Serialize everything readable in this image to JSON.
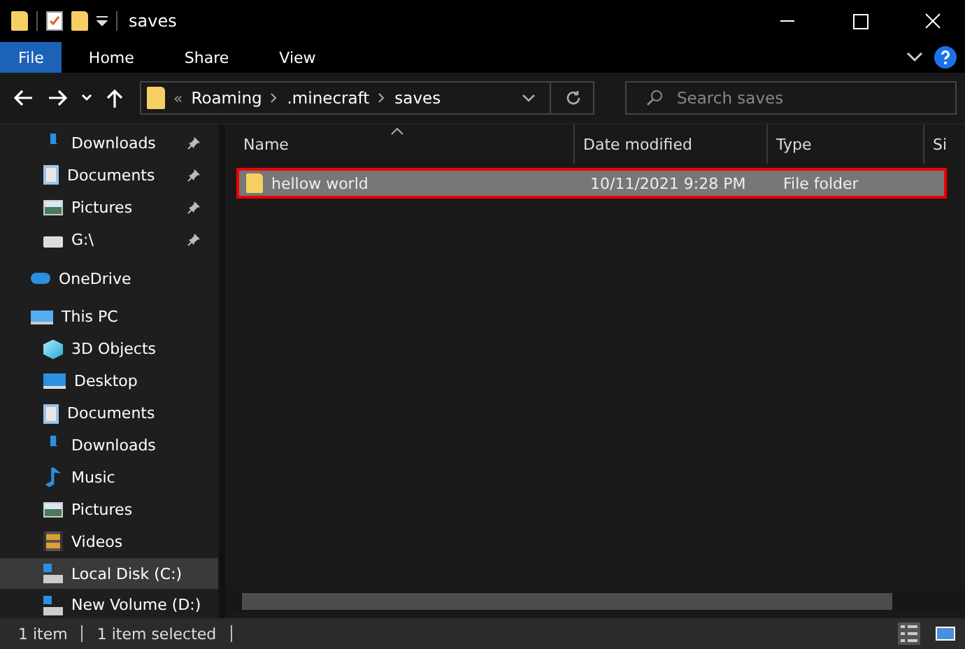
{
  "window": {
    "title": "saves"
  },
  "ribbon_tabs": [
    {
      "label": "File",
      "selected": true
    },
    {
      "label": "Home",
      "selected": false
    },
    {
      "label": "Share",
      "selected": false
    },
    {
      "label": "View",
      "selected": false
    }
  ],
  "address": {
    "overflow": "«",
    "crumbs": [
      "Roaming",
      ".minecraft",
      "saves"
    ]
  },
  "search": {
    "placeholder": "Search saves"
  },
  "sidebar": {
    "quick_access": [
      {
        "label": "Downloads",
        "kind": "downloads",
        "pinned": true,
        "selected": false
      },
      {
        "label": "Documents",
        "kind": "documents",
        "pinned": true,
        "selected": false
      },
      {
        "label": "Pictures",
        "kind": "pictures",
        "pinned": true,
        "selected": false
      },
      {
        "label": "G:\\",
        "kind": "netdrive",
        "pinned": true,
        "selected": false
      }
    ],
    "roots": [
      {
        "label": "OneDrive",
        "kind": "cloud",
        "selected": false
      },
      {
        "label": "This PC",
        "kind": "pc",
        "selected": false,
        "children": [
          {
            "label": "3D Objects",
            "kind": "cube",
            "selected": false
          },
          {
            "label": "Desktop",
            "kind": "desktop",
            "selected": false
          },
          {
            "label": "Documents",
            "kind": "documents",
            "selected": false
          },
          {
            "label": "Downloads",
            "kind": "downloads",
            "selected": false
          },
          {
            "label": "Music",
            "kind": "music",
            "selected": false
          },
          {
            "label": "Pictures",
            "kind": "pictures",
            "selected": false
          },
          {
            "label": "Videos",
            "kind": "videos",
            "selected": false
          },
          {
            "label": "Local Disk (C:)",
            "kind": "disk",
            "selected": true
          },
          {
            "label": "New Volume (D:)",
            "kind": "disk",
            "selected": false
          }
        ]
      }
    ]
  },
  "table": {
    "columns": [
      "Name",
      "Date modified",
      "Type",
      "Si"
    ],
    "rows": [
      {
        "name": "hellow world",
        "date_modified": "10/11/2021 9:28 PM",
        "type": "File folder",
        "selected": true
      }
    ]
  },
  "status_bar": {
    "count": "1 item",
    "selection": "1 item selected"
  }
}
